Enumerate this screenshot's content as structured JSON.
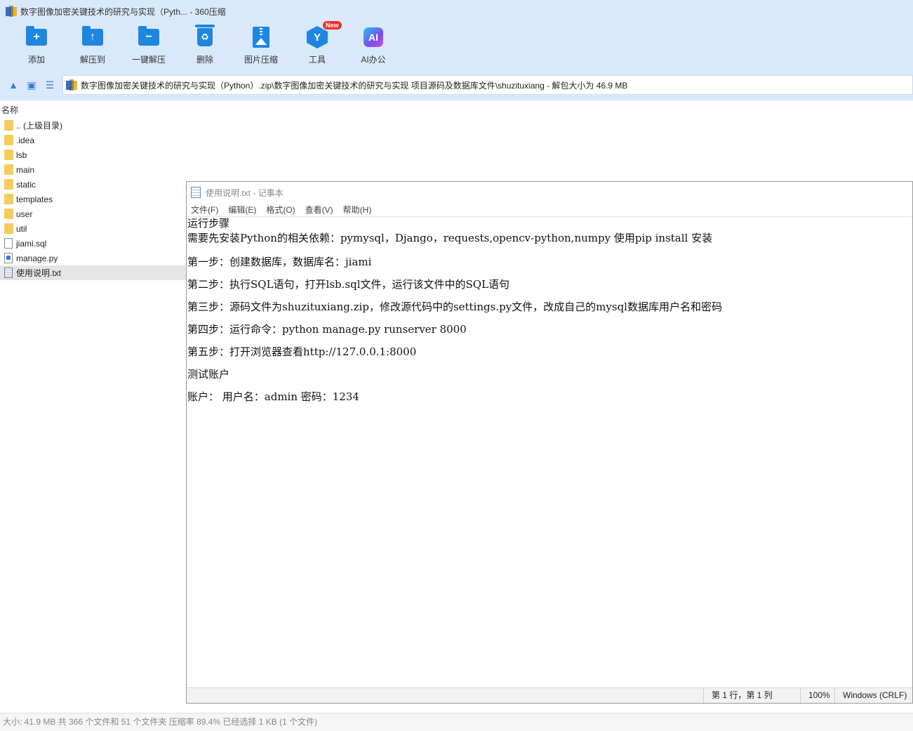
{
  "window": {
    "title": "数字图像加密关键技术的研究与实现（Pyth... - 360压缩"
  },
  "toolbar": {
    "buttons": [
      {
        "label": "添加",
        "icon": "add-folder-icon"
      },
      {
        "label": "解压到",
        "icon": "extract-to-icon"
      },
      {
        "label": "一键解压",
        "icon": "one-click-extract-icon"
      },
      {
        "label": "删除",
        "icon": "delete-trash-icon"
      },
      {
        "label": "图片压缩",
        "icon": "image-compress-icon"
      },
      {
        "label": "工具",
        "icon": "tools-icon",
        "badge": "New"
      },
      {
        "label": "AI办公",
        "icon": "ai-office-icon",
        "icon_text": "AI"
      }
    ]
  },
  "address": {
    "path": "数字图像加密关键技术的研究与实现（Python）.zip\\数字图像加密关键技术的研究与实现 项目源码及数据库文件\\shuzituxiang - 解包大小为 46.9 MB"
  },
  "file_list": {
    "header": "名称",
    "items": [
      {
        "name": ".. (上级目录)",
        "type": "folder"
      },
      {
        "name": ".idea",
        "type": "folder"
      },
      {
        "name": "lsb",
        "type": "folder"
      },
      {
        "name": "main",
        "type": "folder"
      },
      {
        "name": "static",
        "type": "folder"
      },
      {
        "name": "templates",
        "type": "folder"
      },
      {
        "name": "user",
        "type": "folder"
      },
      {
        "name": "util",
        "type": "folder"
      },
      {
        "name": "jiami.sql",
        "type": "file"
      },
      {
        "name": "manage.py",
        "type": "py"
      },
      {
        "name": "使用说明.txt",
        "type": "txt",
        "selected": true
      }
    ]
  },
  "notepad": {
    "title": "使用说明.txt - 记事本",
    "menu": [
      "文件(F)",
      "编辑(E)",
      "格式(O)",
      "查看(V)",
      "帮助(H)"
    ],
    "lines": [
      "运行步骤",
      "需要先安装Python的相关依赖：pymysql，Django，requests,opencv-python,numpy 使用pip install 安装",
      "第一步：创建数据库，数据库名：jiami",
      "第二步：执行SQL语句，打开lsb.sql文件，运行该文件中的SQL语句",
      "第三步：源码文件为shuzituxiang.zip，修改源代码中的settings.py文件，改成自己的mysql数据库用户名和密码",
      "第四步：运行命令：python manage.py runserver 8000",
      "第五步：打开浏览器查看http://127.0.0.1:8000",
      "测试账户",
      "账户： 用户名：admin 密码：1234"
    ],
    "status": {
      "position": "第 1 行，第 1 列",
      "zoom": "100%",
      "encoding": "Windows (CRLF)"
    }
  },
  "statusbar": {
    "text": "大小: 41.9 MB 共 366 个文件和 51 个文件夹 压缩率 89.4% 已经选择 1 KB (1 个文件)"
  }
}
